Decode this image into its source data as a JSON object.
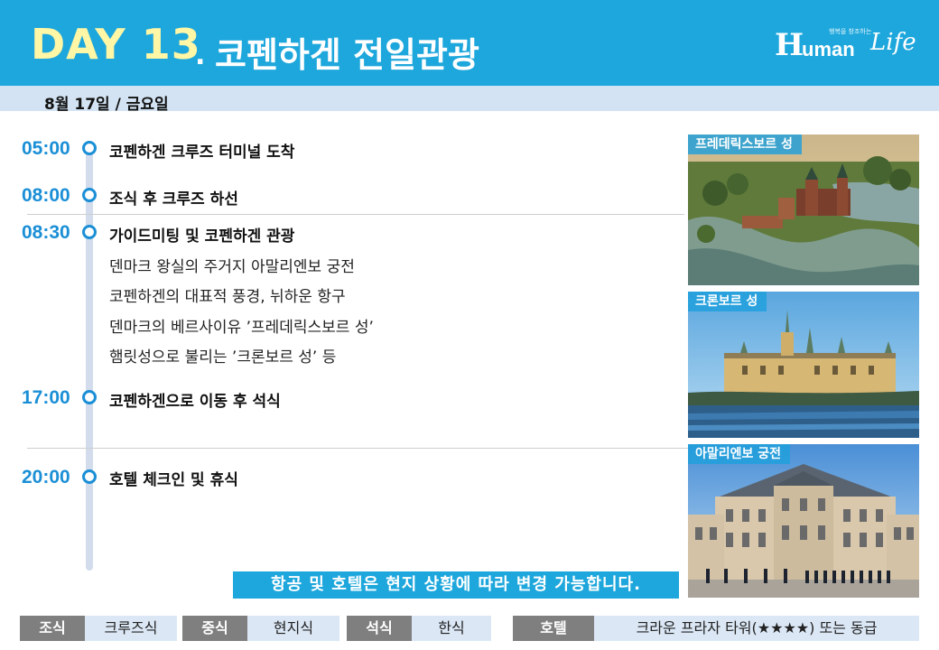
{
  "header": {
    "day": "DAY 13",
    "dot": ".",
    "title": "코펜하겐 전일관광",
    "logo": {
      "h": "H",
      "uman": "uman",
      "life": "Life",
      "tag": "행복을 창조하는"
    }
  },
  "date": "8월 17일 / 금요일",
  "schedule": [
    {
      "time": "05:00",
      "title": "코펜하겐 크루즈 터미널 도착"
    },
    {
      "time": "08:00",
      "title": "조식 후 크루즈 하선"
    },
    {
      "time": "08:30",
      "title": "가이드미팅 및 코펜하겐 관광",
      "details": [
        "덴마크 왕실의 주거지 아말리엔보 궁전",
        "코펜하겐의 대표적 풍경, 뉘하운 항구",
        "덴마크의 베르사이유 ’프레데릭스보르 성’",
        "햄릿성으로 불리는 ’크론보르 성’ 등"
      ]
    },
    {
      "time": "17:00",
      "title": "코펜하겐으로 이동 후 석식"
    },
    {
      "time": "20:00",
      "title": "호텔 체크인 및 휴식"
    }
  ],
  "photos": [
    {
      "caption": "프레데릭스보르 성"
    },
    {
      "caption": "크론보르 성"
    },
    {
      "caption": "아말리엔보 궁전"
    }
  ],
  "notice": "항공 및 호텔은 현지 상황에 따라 변경 가능합니다.",
  "meals": {
    "breakfast_label": "조식",
    "breakfast": "크루즈식",
    "lunch_label": "중식",
    "lunch": "현지식",
    "dinner_label": "석식",
    "dinner": "한식",
    "hotel_label": "호텔",
    "hotel": "크라운 프라자 타워(★★★★) 또는 동급"
  },
  "colors": {
    "accent": "#1ea7dc",
    "time": "#1b8fd6",
    "day_title": "#fff6a6",
    "date_bar": "#d3e3f3",
    "meal_label": "#7f7f7f",
    "meal_value": "#dbe7f5"
  }
}
